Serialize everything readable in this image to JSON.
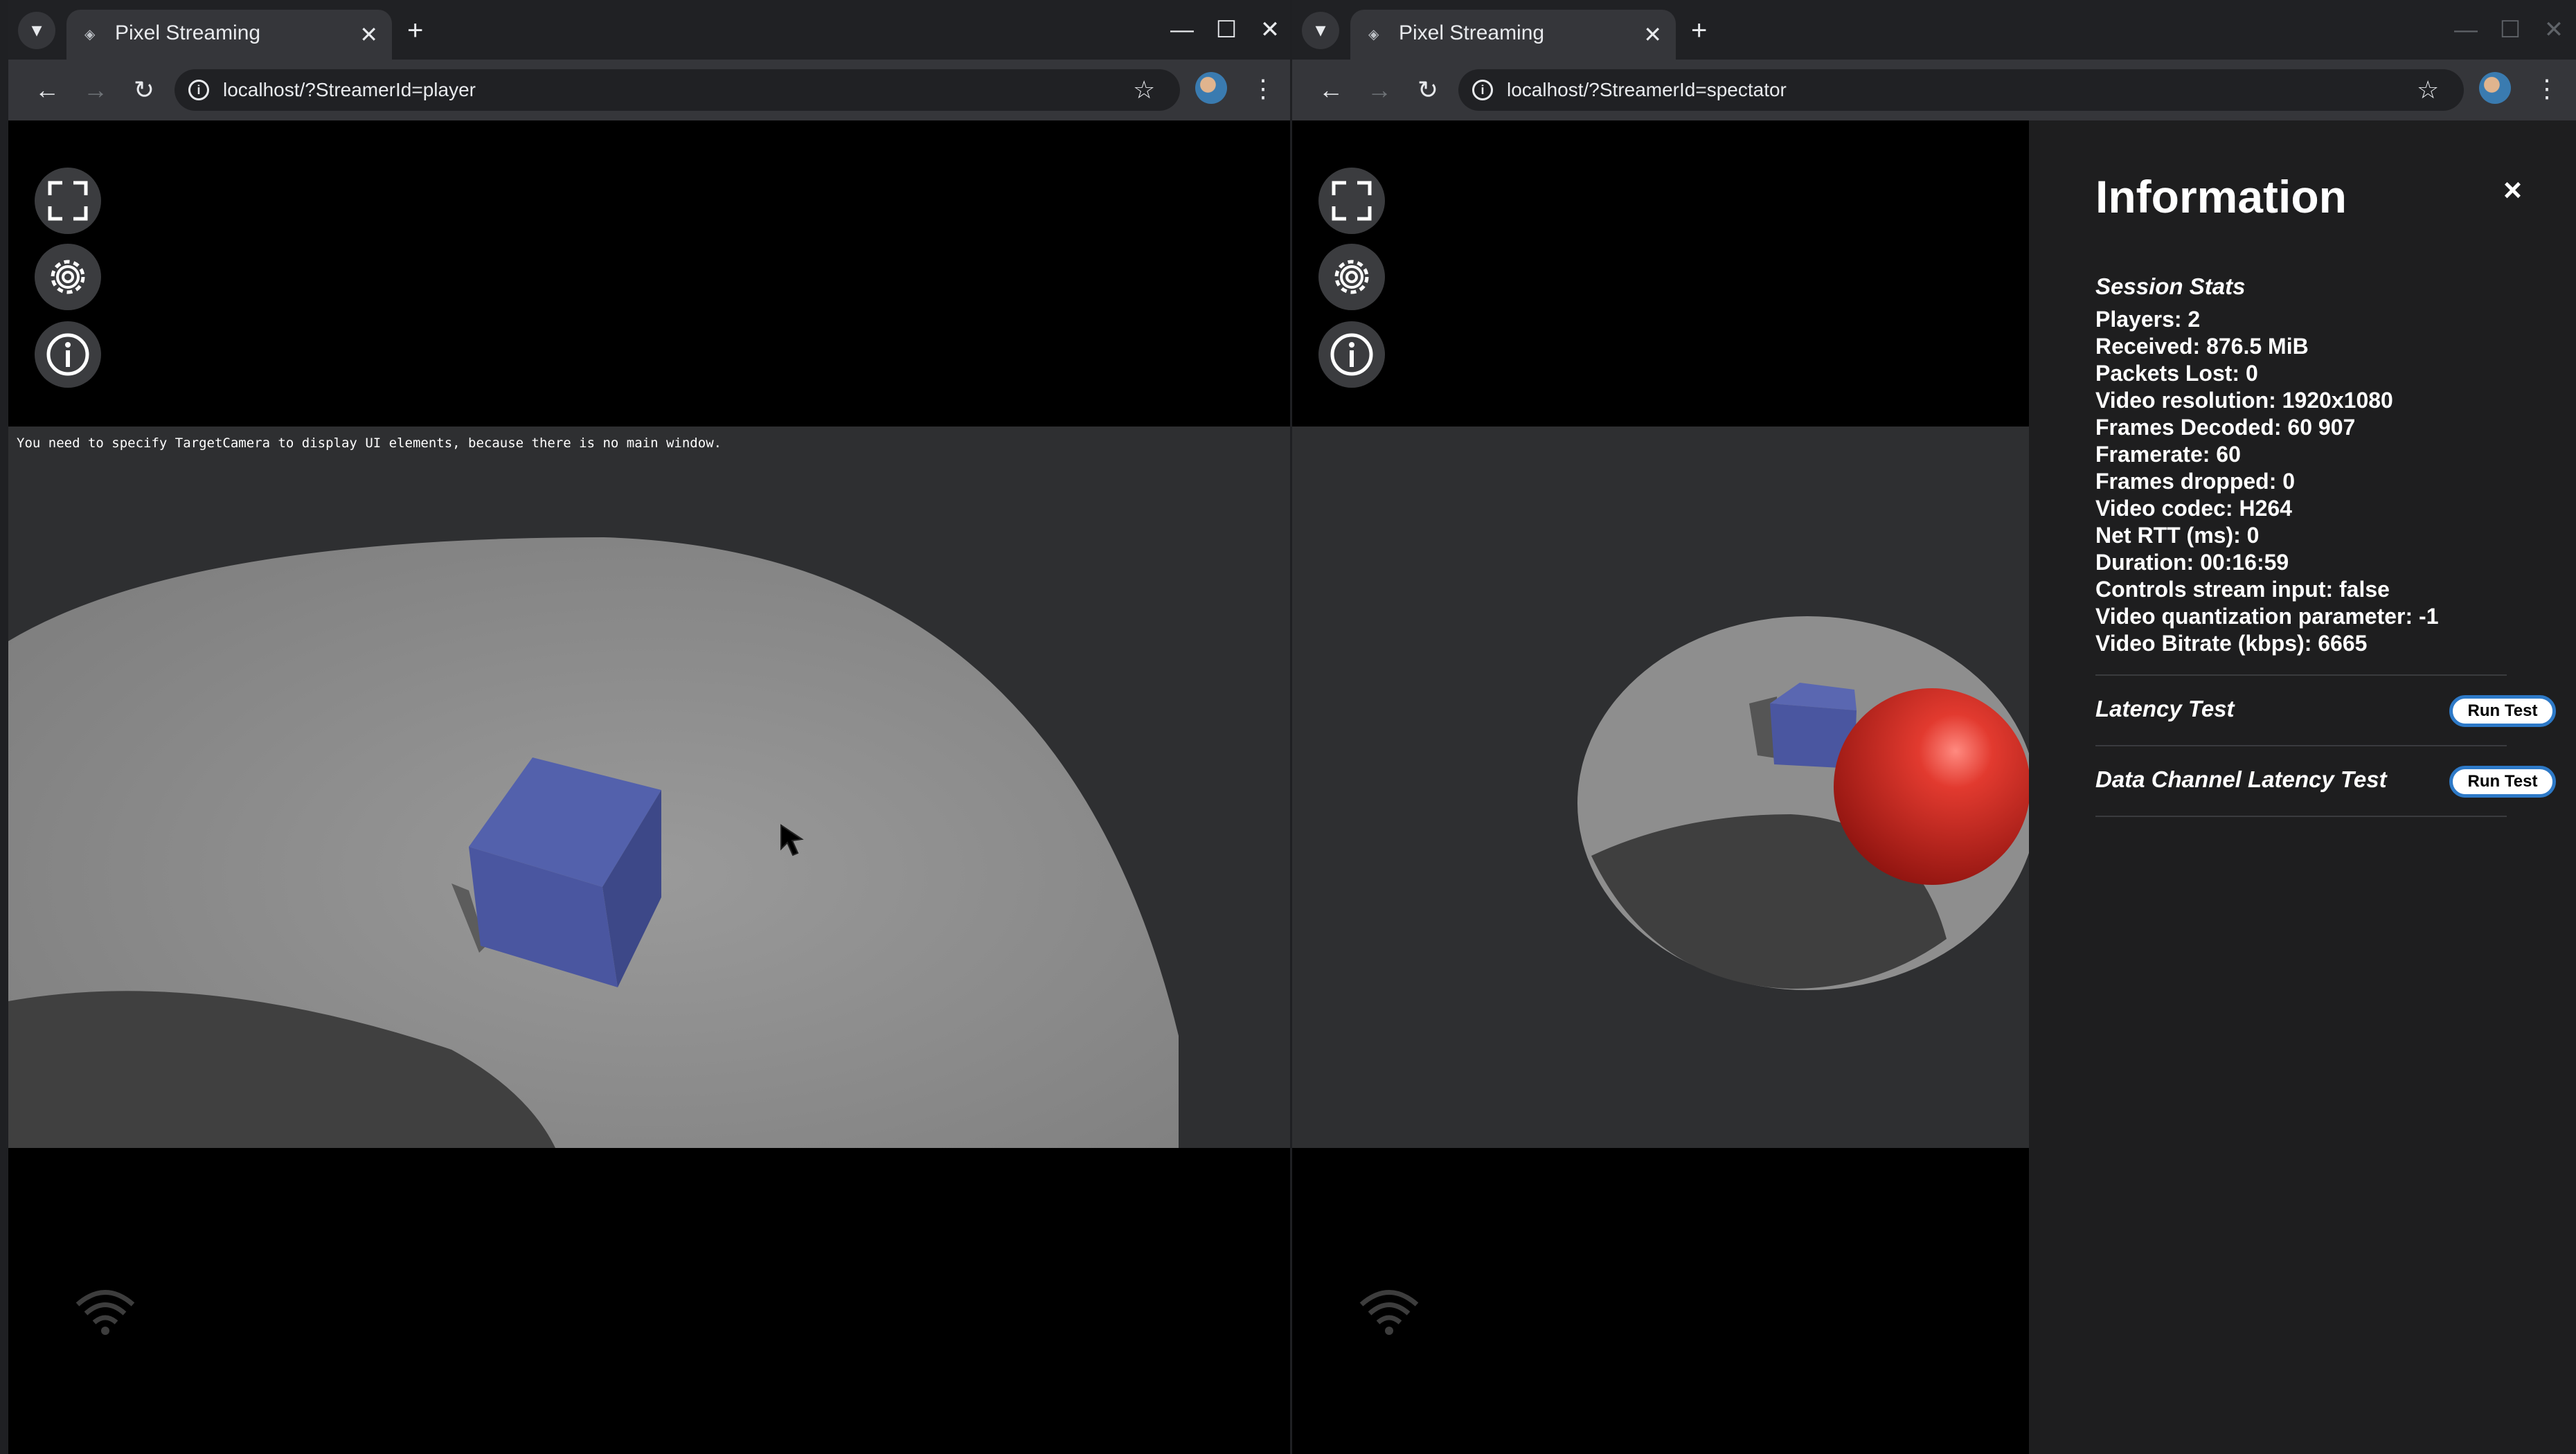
{
  "left_window": {
    "tab": {
      "title": "Pixel Streaming",
      "favicon": "ue-favicon"
    },
    "url": "localhost/?StreamerId=player",
    "scene_message": "You need to specify TargetCamera to display UI elements, because there is no main window."
  },
  "right_window": {
    "tab": {
      "title": "Pixel Streaming",
      "favicon": "ue-favicon"
    },
    "url": "localhost/?StreamerId=spectator",
    "info_panel": {
      "title": "Information",
      "close_label": "×",
      "session_stats_heading": "Session Stats",
      "stats": [
        "Players: 2",
        "Received: 876.5 MiB",
        "Packets Lost: 0",
        "Video resolution: 1920x1080",
        "Frames Decoded: 60 907",
        "Framerate: 60",
        "Frames dropped: 0",
        "Video codec: H264",
        "Net RTT (ms): 0",
        "Duration: 00:16:59",
        "Controls stream input: false",
        "Video quantization parameter: -1",
        "Video Bitrate (kbps): 6665"
      ],
      "latency_test_label": "Latency Test",
      "data_channel_test_label": "Data Channel Latency Test",
      "run_test_label": "Run Test"
    }
  },
  "icons": {
    "tab_menu": "▾",
    "close": "✕",
    "new_tab": "+",
    "minimize": "—",
    "maximize": "☐",
    "back": "←",
    "forward": "→",
    "reload": "↻",
    "star": "☆",
    "kebab": "⋮"
  },
  "colors": {
    "run_test_border": "#2d79c7",
    "cube": "#4a56a0",
    "sphere": "#d42b22",
    "ground": "#909090"
  }
}
